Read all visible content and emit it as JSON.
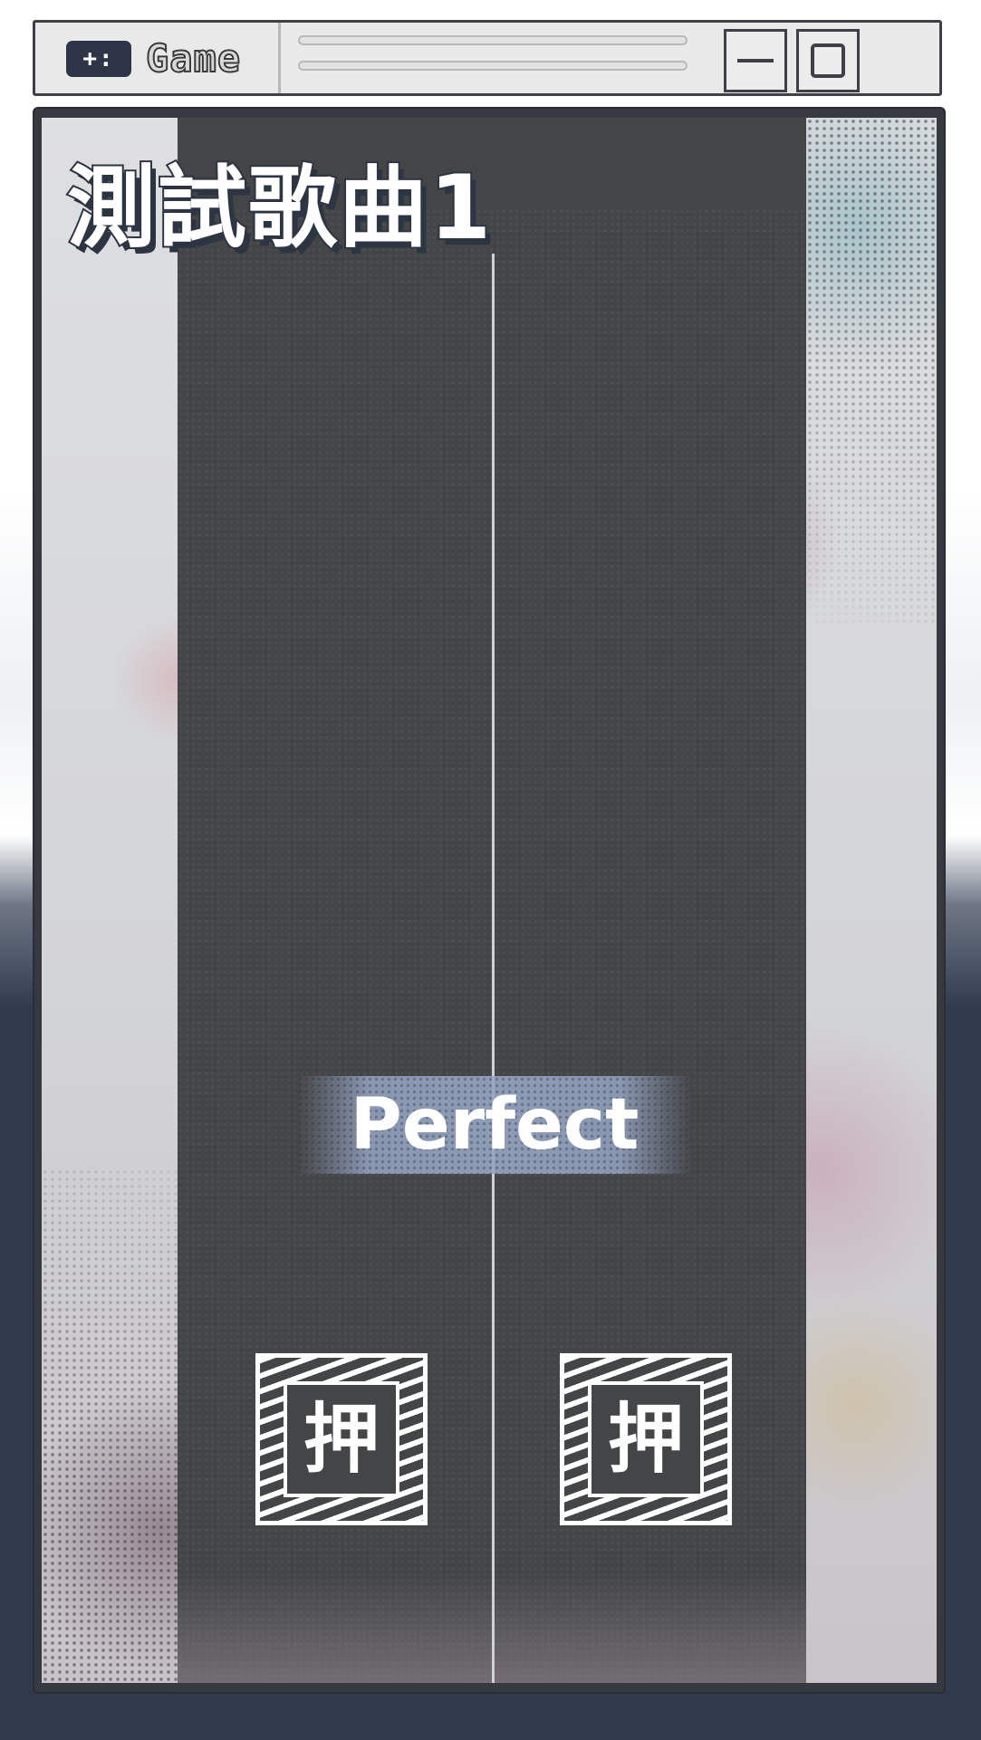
{
  "window": {
    "icon_glyph": "+:",
    "title": "Game"
  },
  "game": {
    "song_title": "測試歌曲1",
    "judgement": "Perfect",
    "keys": [
      {
        "label": "押"
      },
      {
        "label": "押"
      }
    ]
  },
  "colors": {
    "lane": "#444546",
    "frame": "#36393f",
    "accent_dark": "#313a4b",
    "judgement_band": "#96a5c3",
    "text": "#ffffff"
  },
  "icons": [
    "gamepad-icon",
    "minimize-icon",
    "maximize-icon"
  ]
}
